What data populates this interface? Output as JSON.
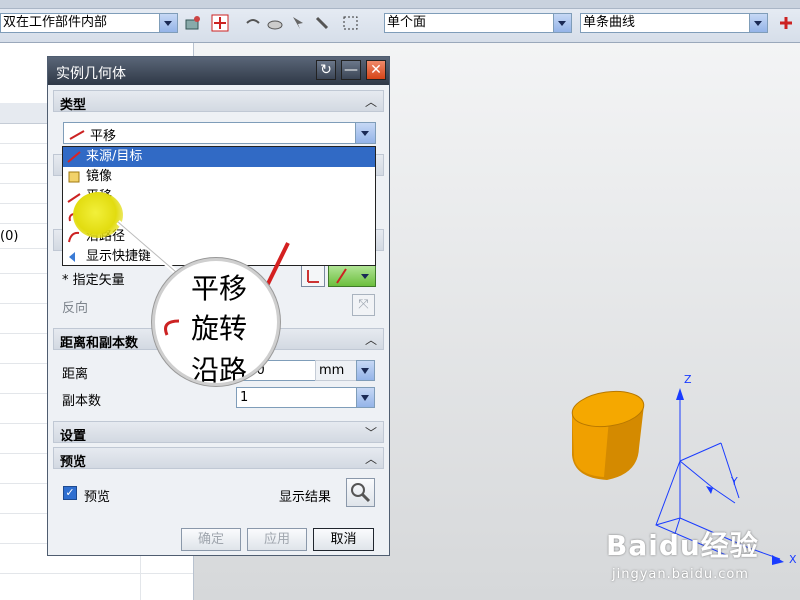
{
  "toolbar": {
    "filter_combo": "双在工作部件内部",
    "face_rule_combo": "单个面",
    "curve_rule_combo": "单条曲线"
  },
  "navigator": {
    "partial_value": "(0)"
  },
  "dialog": {
    "title": "实例几何体",
    "sections": {
      "type": "类型",
      "distance_copies": "距离和副本数",
      "settings": "设置",
      "preview": "预览"
    },
    "type_selected": "平移",
    "type_options": [
      {
        "label": "来源/目标",
        "icon": "source-target-icon",
        "selected": true
      },
      {
        "label": "镜像",
        "icon": "mirror-icon",
        "selected": false
      },
      {
        "label": "平移",
        "icon": "translate-icon",
        "selected": false
      },
      {
        "label": "旋转",
        "icon": "rotate-icon",
        "selected": false
      },
      {
        "label": "沿路径",
        "icon": "path-icon",
        "selected": false
      },
      {
        "label": "显示快捷键",
        "icon": "shortcut-icon",
        "selected": false
      }
    ],
    "specify_vector_label": "* 指定矢量",
    "reverse_label": "反向",
    "distance_label": "距离",
    "distance_value": "100",
    "distance_unit": "mm",
    "copies_label": "副本数",
    "copies_value": "1",
    "preview_checkbox_label": "预览",
    "show_result_label": "显示结果",
    "buttons": {
      "ok": "确定",
      "apply": "应用",
      "cancel": "取消"
    }
  },
  "magnifier": {
    "lines": [
      "平移",
      "旋转",
      "沿路"
    ]
  },
  "axes": {
    "x": "X",
    "y": "Y",
    "z": "Z"
  },
  "watermark": {
    "brand": "Baidu经验",
    "url": "jingyan.baidu.com"
  },
  "colors": {
    "selection": "#316ac5",
    "cylinder": "#f0a000",
    "axis": "#1a3cff",
    "close_button": "#e0542a"
  }
}
